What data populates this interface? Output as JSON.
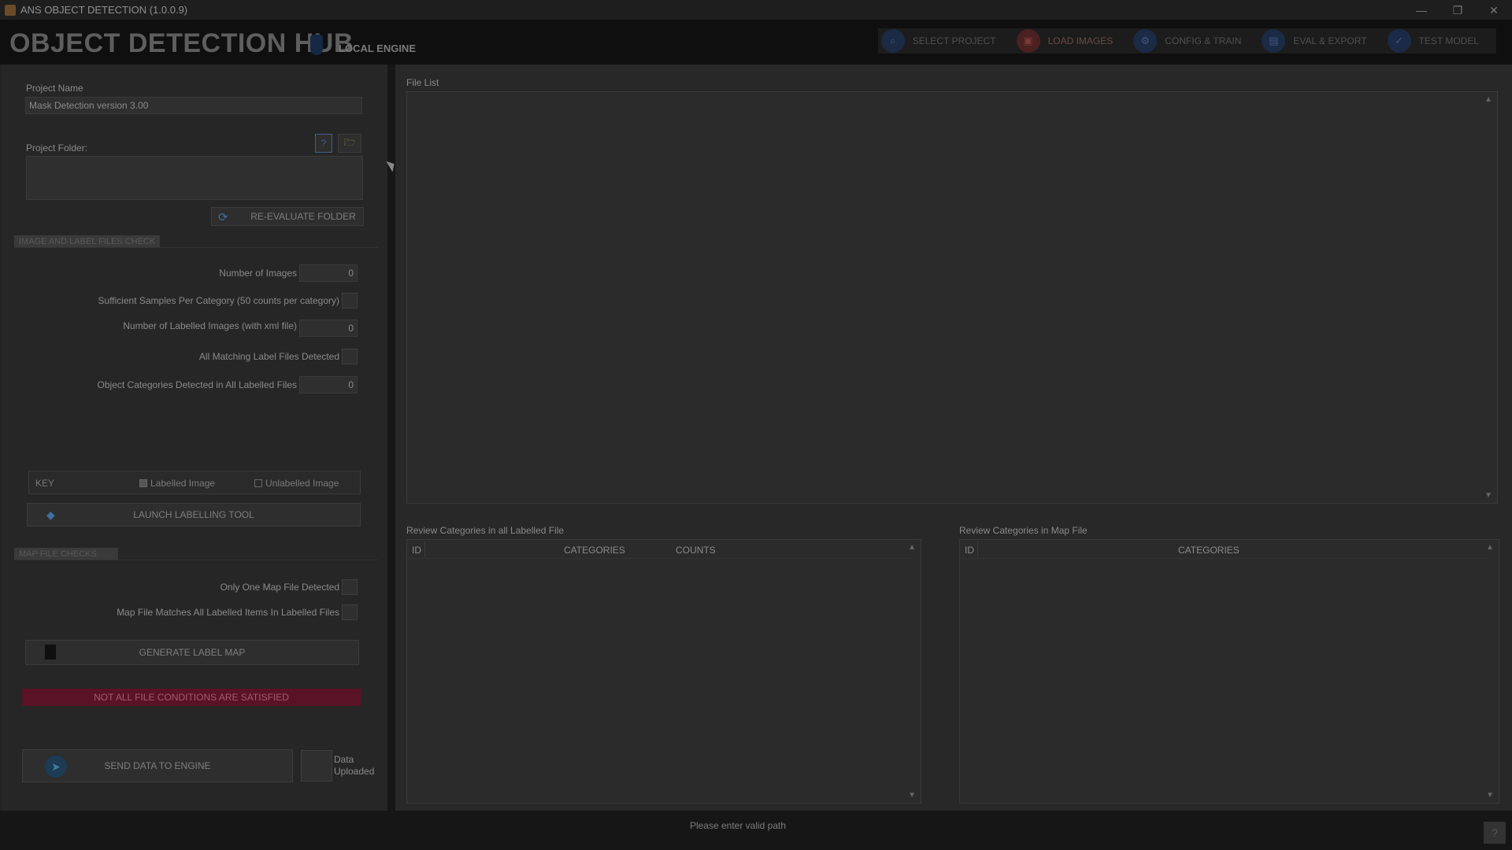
{
  "window": {
    "title": "ANS OBJECT DETECTION (1.0.0.9)",
    "minimize": "—",
    "maximize": "❐",
    "close": "✕"
  },
  "header": {
    "brand": "OBJECT DETECTION HUB",
    "engine_label": "LOCAL ENGINE",
    "nav": [
      {
        "label": "SELECT PROJECT",
        "icon": "search-icon",
        "glyph": "⌕"
      },
      {
        "label": "LOAD IMAGES",
        "icon": "image-icon",
        "glyph": "▣"
      },
      {
        "label": "CONFIG & TRAIN",
        "icon": "gear-icon",
        "glyph": "⚙"
      },
      {
        "label": "EVAL & EXPORT",
        "icon": "clipboard-icon",
        "glyph": "▤"
      },
      {
        "label": "TEST MODEL",
        "icon": "check-icon",
        "glyph": "✓"
      }
    ],
    "active_nav": "LOAD IMAGES"
  },
  "left": {
    "project_name_label": "Project Name",
    "project_name_value": "Mask Detection version 3.00",
    "project_folder_label": "Project Folder:",
    "help_glyph": "?",
    "folder_glyph": "🗁",
    "reevaluate_button": "RE-EVALUATE FOLDER",
    "image_checks_section": "IMAGE AND LABEL FILES CHECK",
    "num_images_label": "Number of Images",
    "num_images_value": "0",
    "sufficient_samples_label": "Sufficient Samples Per Category (50 counts per category)",
    "num_labelled_label": "Number of Labelled Images (with xml file)",
    "num_labelled_value": "0",
    "all_matching_label": "All Matching Label Files Detected",
    "categories_detected_label": "Object Categories Detected in All Labelled Files",
    "categories_detected_value": "0",
    "key_label": "KEY",
    "key_labelled": "Labelled Image",
    "key_unlabelled": "Unlabelled Image",
    "launch_labelling_button": "LAUNCH LABELLING TOOL",
    "map_checks_section": "MAP FILE CHECKS",
    "only_one_map_label": "Only One Map File Detected",
    "map_matches_label": "Map File Matches All Labelled Items In Labelled Files",
    "generate_map_button": "GENERATE LABEL MAP",
    "alert_text": "NOT ALL FILE CONDITIONS ARE SATISFIED",
    "send_button": "SEND DATA TO ENGINE",
    "data_uploaded_line1": "Data",
    "data_uploaded_line2": "Uploaded"
  },
  "right": {
    "file_list_label": "File List",
    "review_labelled_label": "Review Categories in all Labelled File",
    "review_labelled_columns": [
      "ID",
      "CATEGORIES",
      "COUNTS"
    ],
    "review_map_label": "Review Categories in Map File",
    "review_map_columns": [
      "ID",
      "CATEGORIES"
    ]
  },
  "status": {
    "message": "Please enter valid path",
    "help_glyph": "?"
  },
  "colors": {
    "alert_bg": "#5a1226",
    "active_nav": "#4a2020",
    "nav_icon_bg": "#1b2a45"
  }
}
